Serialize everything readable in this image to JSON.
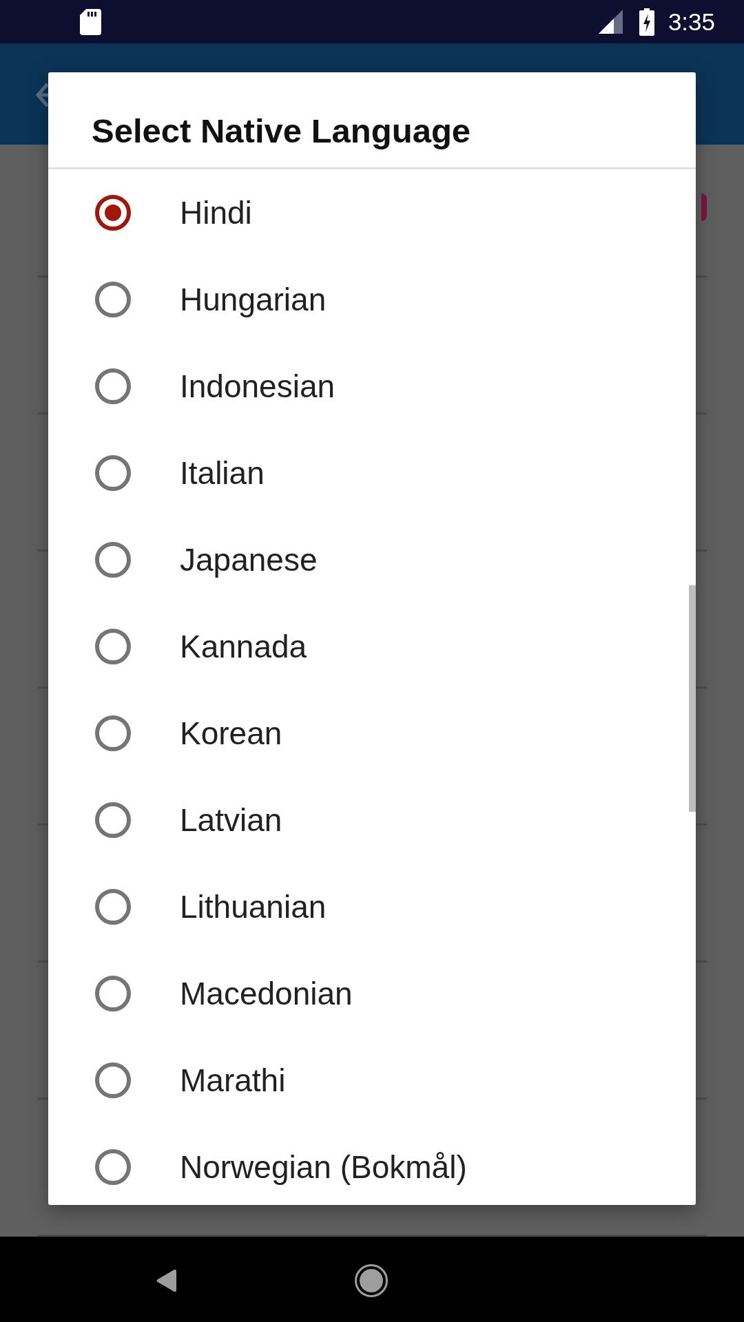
{
  "status_bar": {
    "time": "3:35"
  },
  "dialog": {
    "title": "Select Native Language",
    "options": [
      {
        "label": "Hindi",
        "selected": true
      },
      {
        "label": "Hungarian",
        "selected": false
      },
      {
        "label": "Indonesian",
        "selected": false
      },
      {
        "label": "Italian",
        "selected": false
      },
      {
        "label": "Japanese",
        "selected": false
      },
      {
        "label": "Kannada",
        "selected": false
      },
      {
        "label": "Korean",
        "selected": false
      },
      {
        "label": "Latvian",
        "selected": false
      },
      {
        "label": "Lithuanian",
        "selected": false
      },
      {
        "label": "Macedonian",
        "selected": false
      },
      {
        "label": "Marathi",
        "selected": false
      },
      {
        "label": "Norwegian (Bokmål)",
        "selected": false
      }
    ]
  }
}
